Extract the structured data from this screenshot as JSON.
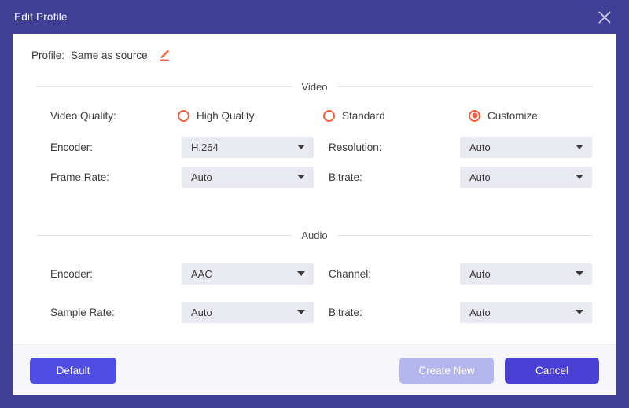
{
  "window": {
    "title": "Edit Profile",
    "close_icon": "close-icon",
    "accent_purple": "#3f3f96",
    "accent_orange": "#f4603e",
    "button_blue": "#4e4ee4"
  },
  "profile": {
    "label": "Profile:",
    "value": "Same as source",
    "edit_icon": "pencil-edit-icon"
  },
  "video": {
    "section_title": "Video",
    "quality": {
      "label": "Video Quality:",
      "options": [
        {
          "label": "High Quality",
          "selected": false
        },
        {
          "label": "Standard",
          "selected": false
        },
        {
          "label": "Customize",
          "selected": true
        }
      ]
    },
    "fields": [
      {
        "label": "Encoder:",
        "value": "H.264"
      },
      {
        "label": "Resolution:",
        "value": "Auto"
      },
      {
        "label": "Frame Rate:",
        "value": "Auto"
      },
      {
        "label": "Bitrate:",
        "value": "Auto"
      }
    ]
  },
  "audio": {
    "section_title": "Audio",
    "fields": [
      {
        "label": "Encoder:",
        "value": "AAC"
      },
      {
        "label": "Channel:",
        "value": "Auto"
      },
      {
        "label": "Sample Rate:",
        "value": "Auto"
      },
      {
        "label": "Bitrate:",
        "value": "Auto"
      }
    ]
  },
  "footer": {
    "default_label": "Default",
    "create_new_label": "Create New",
    "cancel_label": "Cancel"
  }
}
